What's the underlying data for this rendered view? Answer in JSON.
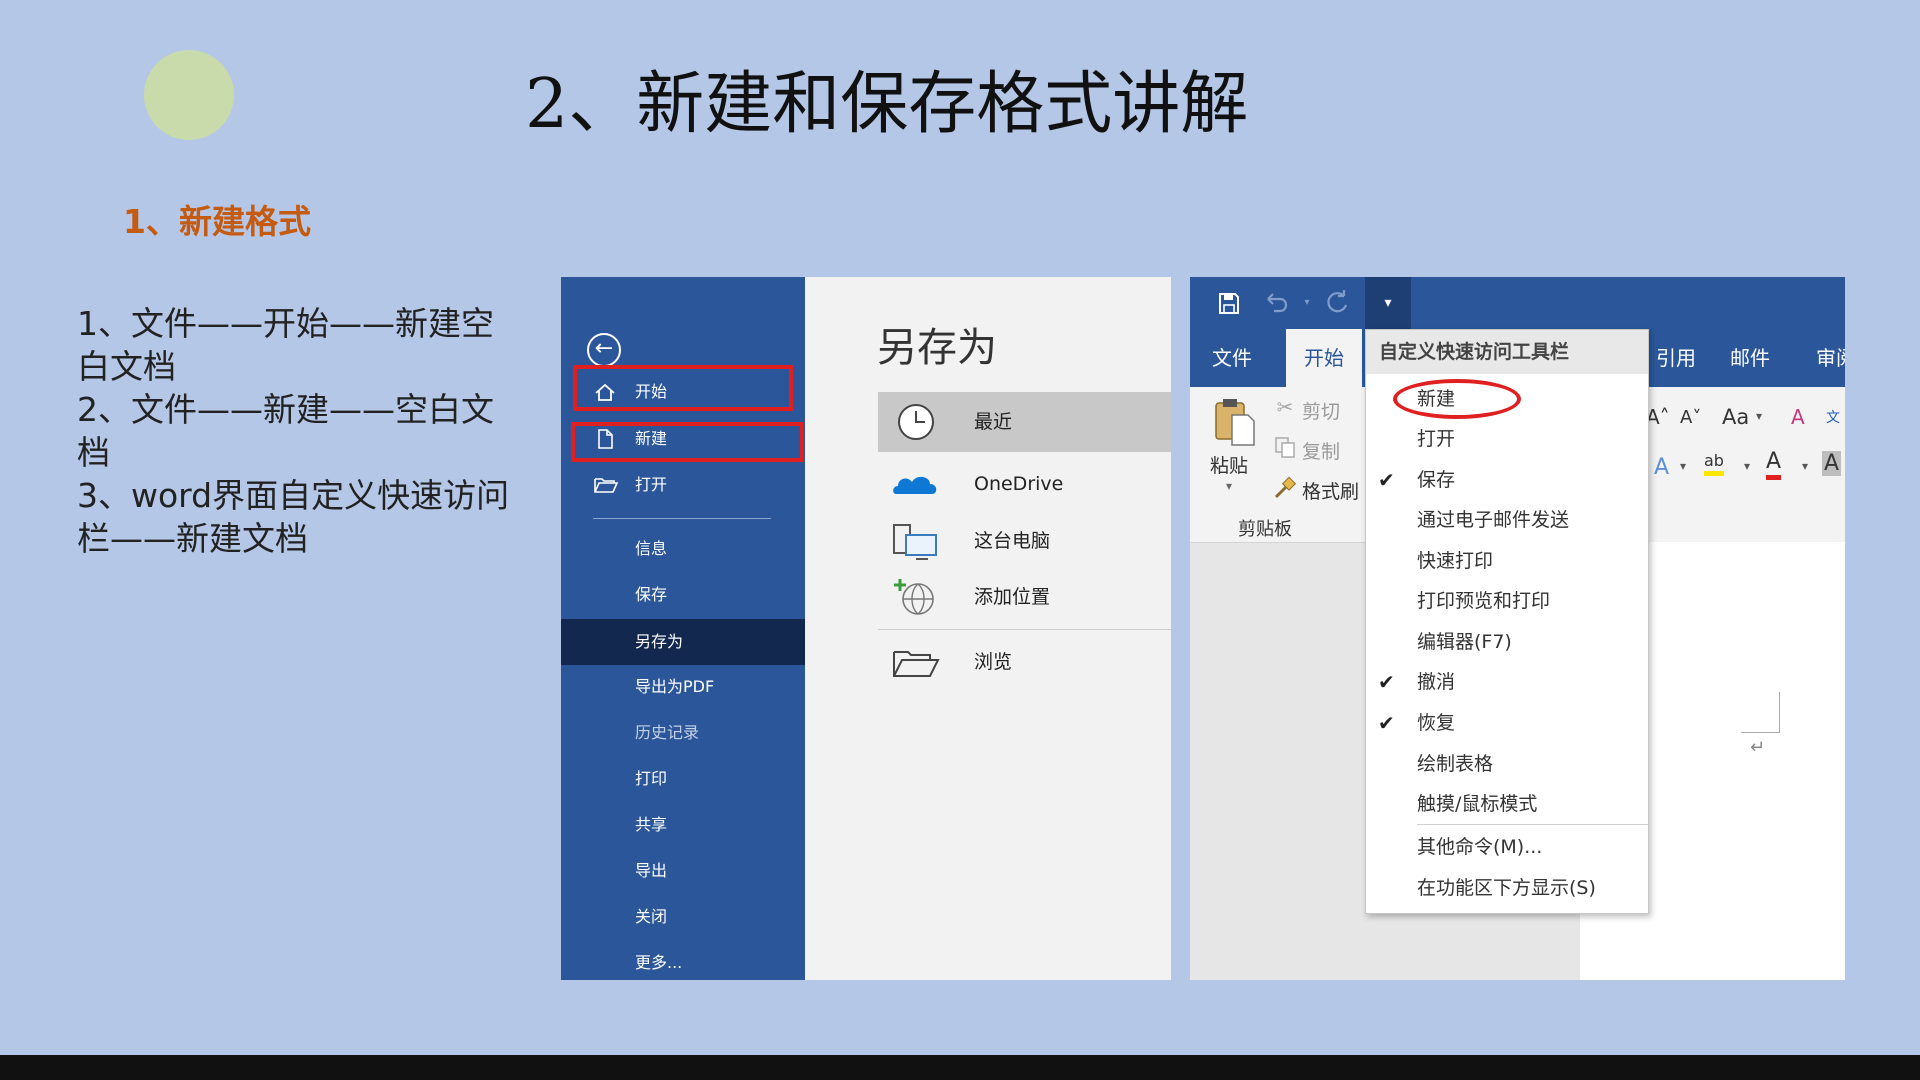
{
  "slide": {
    "title": "2、新建和保存格式讲解",
    "section_heading": "1、新建格式",
    "steps": [
      "1、文件——开始——新建空白文档",
      "2、文件——新建——空白文档",
      "3、word界面自定义快速访问栏——新建文档"
    ]
  },
  "backstage": {
    "back_icon": "←",
    "nav": [
      {
        "label": "开始",
        "icon": "home-icon",
        "highlighted": true
      },
      {
        "label": "新建",
        "icon": "new-document-icon",
        "highlighted": true
      },
      {
        "label": "打开",
        "icon": "open-folder-icon"
      },
      {
        "label": "信息"
      },
      {
        "label": "保存"
      },
      {
        "label": "另存为",
        "selected": true
      },
      {
        "label": "导出为PDF"
      },
      {
        "label": "历史记录",
        "disabled": true
      },
      {
        "label": "打印"
      },
      {
        "label": "共享"
      },
      {
        "label": "导出"
      },
      {
        "label": "关闭"
      },
      {
        "label": "更多..."
      }
    ],
    "title": "另存为",
    "locations": [
      {
        "label": "最近",
        "icon": "clock-icon",
        "selected": true
      },
      {
        "label": "OneDrive",
        "icon": "cloud-icon"
      },
      {
        "label": "这台电脑",
        "icon": "computer-icon"
      },
      {
        "label": "添加位置",
        "icon": "add-location-icon"
      },
      {
        "label": "浏览",
        "icon": "folder-icon"
      }
    ]
  },
  "word": {
    "qat": {
      "save_icon": "save-icon",
      "undo_icon": "undo-icon",
      "redo_icon": "redo-icon",
      "customize_icon": "dropdown-icon"
    },
    "tabs": {
      "file": "文件",
      "home": "开始",
      "references": "引用",
      "mailings": "邮件",
      "review": "审阅"
    },
    "clipboard": {
      "paste": "粘贴",
      "cut": "剪切",
      "copy": "复制",
      "format_painter": "格式刷",
      "group_label": "剪贴板"
    },
    "font_controls": {
      "grow_font": "A˄",
      "shrink_font": "A˅",
      "change_case": "Aa",
      "clear_format": "A",
      "phonetic": "文",
      "text_effects": "A",
      "highlight": "ab",
      "font_color": "A",
      "char_shading": "A"
    },
    "quick_access_menu": {
      "title": "自定义快速访问工具栏",
      "items": [
        {
          "label": "新建",
          "checked": false,
          "circled": true
        },
        {
          "label": "打开",
          "checked": false
        },
        {
          "label": "保存",
          "checked": true
        },
        {
          "label": "通过电子邮件发送",
          "checked": false
        },
        {
          "label": "快速打印",
          "checked": false
        },
        {
          "label": "打印预览和打印",
          "checked": false
        },
        {
          "label": "编辑器(F7)",
          "checked": false
        },
        {
          "label": "撤消",
          "checked": true
        },
        {
          "label": "恢复",
          "checked": true
        },
        {
          "label": "绘制表格",
          "checked": false
        },
        {
          "label": "触摸/鼠标模式",
          "checked": false
        },
        {
          "label": "其他命令(M)...",
          "checked": false
        },
        {
          "label": "在功能区下方显示(S)",
          "checked": false
        }
      ],
      "check_glyph": "✔"
    },
    "paragraph_mark": "↵"
  },
  "colors": {
    "slide_bg": "#b4c7e7",
    "word_blue": "#2b579a",
    "nav_selected": "#12284f",
    "heading_orange": "#c55a11",
    "highlight_red": "#e02020"
  }
}
